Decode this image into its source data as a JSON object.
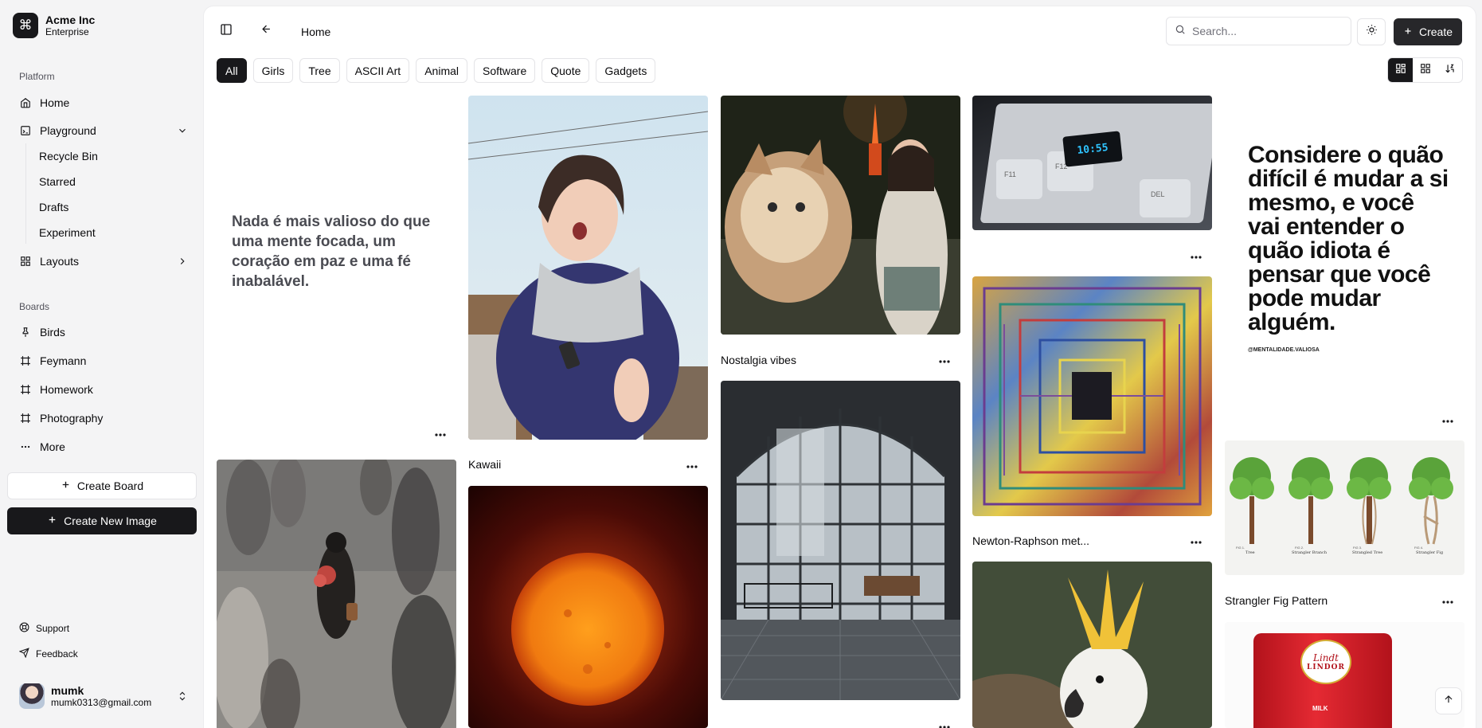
{
  "team": {
    "name": "Acme Inc",
    "plan": "Enterprise"
  },
  "sidebar": {
    "platform_label": "Platform",
    "home": "Home",
    "playground": "Playground",
    "playground_items": [
      "Recycle Bin",
      "Starred",
      "Drafts",
      "Experiment"
    ],
    "layouts": "Layouts",
    "boards_label": "Boards",
    "boards": [
      "Birds",
      "Feymann",
      "Homework",
      "Photography"
    ],
    "more": "More",
    "create_board": "Create Board",
    "create_new_image": "Create New Image",
    "support": "Support",
    "feedback": "Feedback"
  },
  "user": {
    "name": "mumk",
    "email": "mumk0313@gmail.com"
  },
  "header": {
    "breadcrumb": "Home",
    "search_placeholder": "Search...",
    "create_label": "Create"
  },
  "filters": [
    "All",
    "Girls",
    "Tree",
    "ASCII Art",
    "Animal",
    "Software",
    "Quote",
    "Gadgets"
  ],
  "active_filter": "All",
  "gallery": {
    "quote_card_text": "Nada é mais valioso do que uma mente focada, um coração em paz e uma fé inabalável.",
    "quote_poster_text": "Considere o quão difícil é mudar a si mesmo, e você vai entender o quão idiota é pensar que você pode mudar alguém.",
    "quote_poster_handle": "@MENTALIDADE.VALIOSA",
    "keyboard_display": "10:55",
    "keyboard_keys": [
      "F11",
      "F12",
      "DEL"
    ],
    "captions": {
      "kawaii": "Kawaii",
      "nostalgia": "Nostalgia vibes",
      "newton": "Newton-Raphson met...",
      "strangler": "Strangler Fig Pattern"
    },
    "tree_labels": [
      "Tree",
      "Strangler Branch",
      "Strangled Tree",
      "Strangler Fig"
    ],
    "tree_numbers": [
      "FIG 1.",
      "FIG 2.",
      "FIG 3.",
      "FIG 4."
    ],
    "lindt_brand": "Lindt",
    "lindt_product": "LINDOR",
    "lindt_variant": "MILK"
  }
}
